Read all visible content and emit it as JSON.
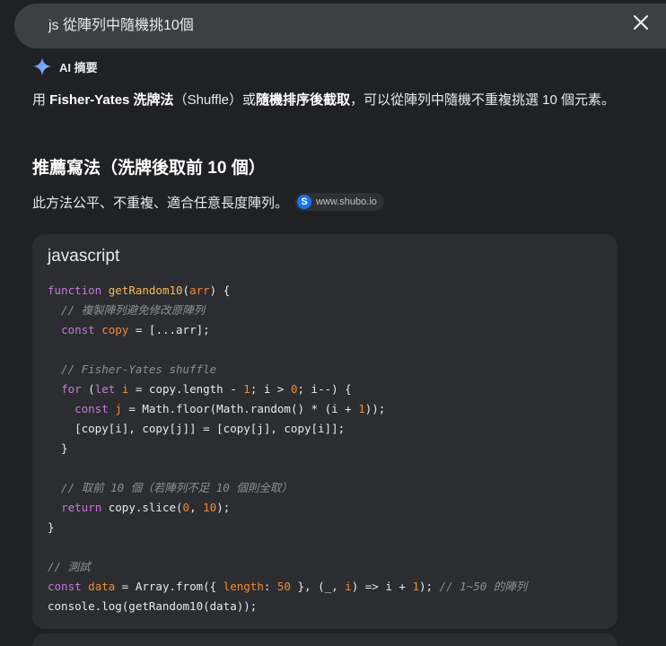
{
  "search": {
    "query": "js 從陣列中隨機挑10個"
  },
  "ai_overview": {
    "label": "AI 摘要",
    "intro": [
      {
        "text": "用 ",
        "bold": false
      },
      {
        "text": "Fisher-Yates 洗牌法",
        "bold": true
      },
      {
        "text": "（Shuffle）或",
        "bold": false
      },
      {
        "text": "隨機排序後截取",
        "bold": true
      },
      {
        "text": "，可以從陣列中隨機不重複挑選 10 個元素。",
        "bold": false
      }
    ],
    "section_title": "推薦寫法（洗牌後取前 10 個）",
    "section_desc": "此方法公平、不重複、適合任意長度陣列。",
    "source": {
      "logo_letter": "S",
      "domain": "www.shubo.io"
    }
  },
  "code_block": {
    "language": "javascript",
    "lines": [
      [
        {
          "t": "function",
          "c": "kw"
        },
        {
          "t": " ",
          "c": ""
        },
        {
          "t": "getRandom10",
          "c": "fn"
        },
        {
          "t": "(",
          "c": ""
        },
        {
          "t": "arr",
          "c": "var"
        },
        {
          "t": ") {",
          "c": ""
        }
      ],
      [
        {
          "t": "  // 複製陣列避免修改原陣列",
          "c": "cm"
        }
      ],
      [
        {
          "t": "  ",
          "c": ""
        },
        {
          "t": "const",
          "c": "kw"
        },
        {
          "t": " ",
          "c": ""
        },
        {
          "t": "copy",
          "c": "var"
        },
        {
          "t": " = [...arr];",
          "c": ""
        }
      ],
      [],
      [
        {
          "t": "  // Fisher-Yates shuffle",
          "c": "cm"
        }
      ],
      [
        {
          "t": "  ",
          "c": ""
        },
        {
          "t": "for",
          "c": "kw"
        },
        {
          "t": " (",
          "c": ""
        },
        {
          "t": "let",
          "c": "kw"
        },
        {
          "t": " ",
          "c": ""
        },
        {
          "t": "i",
          "c": "var"
        },
        {
          "t": " = copy.length - ",
          "c": ""
        },
        {
          "t": "1",
          "c": "num"
        },
        {
          "t": "; i > ",
          "c": ""
        },
        {
          "t": "0",
          "c": "num"
        },
        {
          "t": "; i--) {",
          "c": ""
        }
      ],
      [
        {
          "t": "    ",
          "c": ""
        },
        {
          "t": "const",
          "c": "kw"
        },
        {
          "t": " ",
          "c": ""
        },
        {
          "t": "j",
          "c": "var"
        },
        {
          "t": " = Math.floor(Math.random() * (i + ",
          "c": ""
        },
        {
          "t": "1",
          "c": "num"
        },
        {
          "t": "));",
          "c": ""
        }
      ],
      [
        {
          "t": "    [copy[i], copy[j]] = [copy[j], copy[i]];",
          "c": ""
        }
      ],
      [
        {
          "t": "  }",
          "c": ""
        }
      ],
      [],
      [
        {
          "t": "  // 取前 10 個（若陣列不足 10 個則全取）",
          "c": "cm"
        }
      ],
      [
        {
          "t": "  ",
          "c": ""
        },
        {
          "t": "return",
          "c": "kw"
        },
        {
          "t": " copy.slice(",
          "c": ""
        },
        {
          "t": "0",
          "c": "num"
        },
        {
          "t": ", ",
          "c": ""
        },
        {
          "t": "10",
          "c": "num"
        },
        {
          "t": ");",
          "c": ""
        }
      ],
      [
        {
          "t": "}",
          "c": ""
        }
      ],
      [],
      [
        {
          "t": "// 測試",
          "c": "cm"
        }
      ],
      [
        {
          "t": "const",
          "c": "kw"
        },
        {
          "t": " ",
          "c": ""
        },
        {
          "t": "data",
          "c": "var"
        },
        {
          "t": " = Array.from({ ",
          "c": ""
        },
        {
          "t": "length",
          "c": "var"
        },
        {
          "t": ": ",
          "c": ""
        },
        {
          "t": "50",
          "c": "num"
        },
        {
          "t": " }, (_, ",
          "c": ""
        },
        {
          "t": "i",
          "c": "var"
        },
        {
          "t": ") => i + ",
          "c": ""
        },
        {
          "t": "1",
          "c": "num"
        },
        {
          "t": "); ",
          "c": ""
        },
        {
          "t": "// 1~50 的陣列",
          "c": "cm"
        }
      ],
      [
        {
          "t": "console.log(getRandom10(data));",
          "c": ""
        }
      ]
    ]
  },
  "colors": {
    "background": "#202124",
    "search_bar": "#3c4043",
    "code_card": "#2c2d31",
    "keyword": "#c678dd",
    "function_name": "#f7b955",
    "variable": "#f28b30",
    "comment": "#8a8f98"
  },
  "icons": {
    "close": "close-icon",
    "ai_spark": "sparkle-icon"
  }
}
